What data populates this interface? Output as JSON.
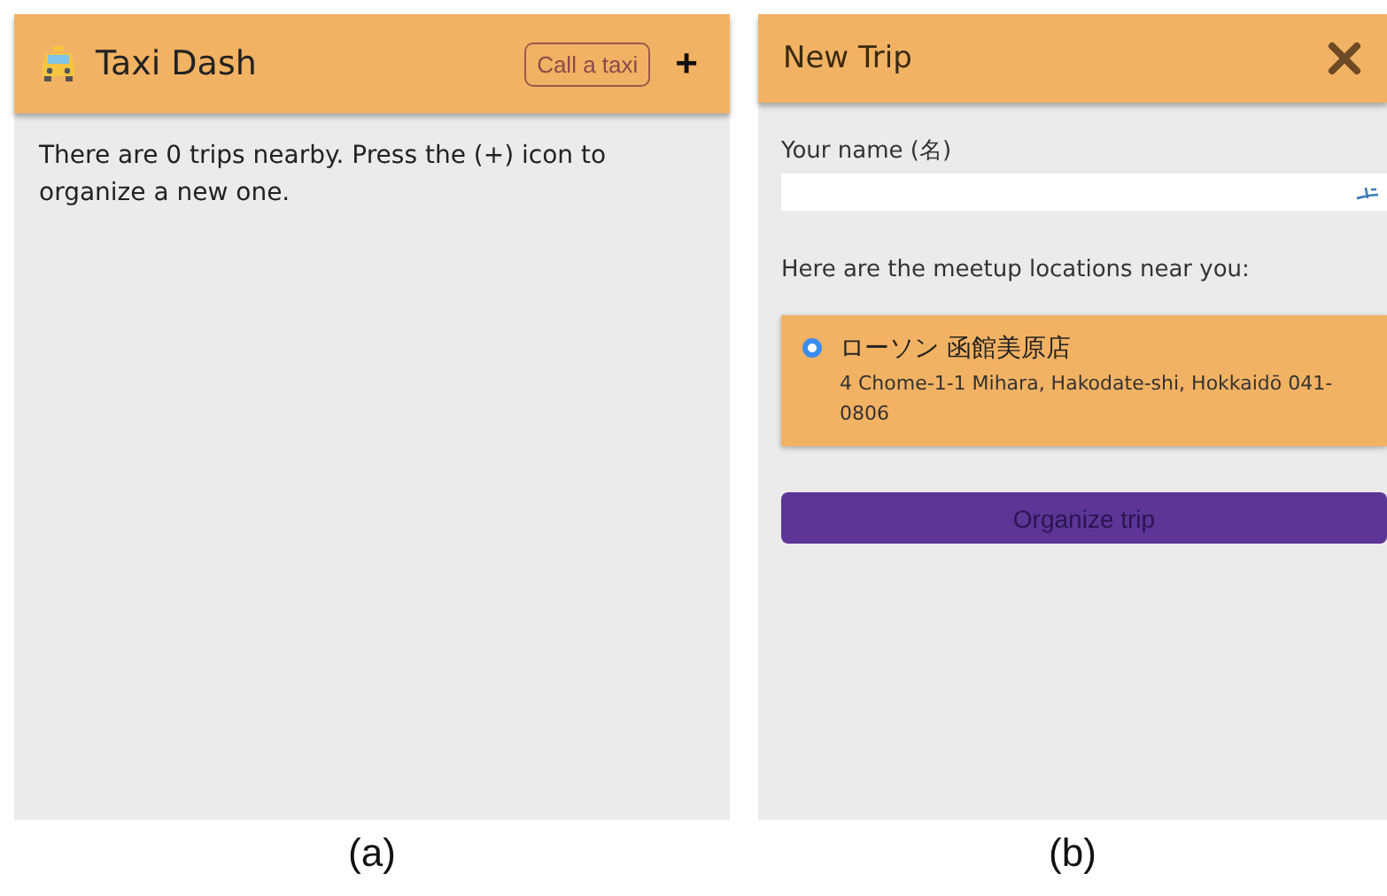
{
  "panels": [
    {
      "caption": "(a)",
      "header": {
        "title": "Taxi Dash",
        "call_button": "Call a taxi",
        "add_button": "+"
      },
      "message": "There are 0 trips nearby. Press the (+) icon to organize a new one."
    },
    {
      "caption": "(b)",
      "header": {
        "title": "New Trip"
      },
      "name_field": {
        "label": "Your name (名)"
      },
      "locations_label": "Here are the meetup locations near you:",
      "locations": [
        {
          "name": "ローソン 函館美原店",
          "address": "4 Chome-1-1 Mihara, Hakodate-shi, Hokkaidō 041-0806",
          "selected": true
        }
      ],
      "submit_button": "Organize trip"
    }
  ]
}
